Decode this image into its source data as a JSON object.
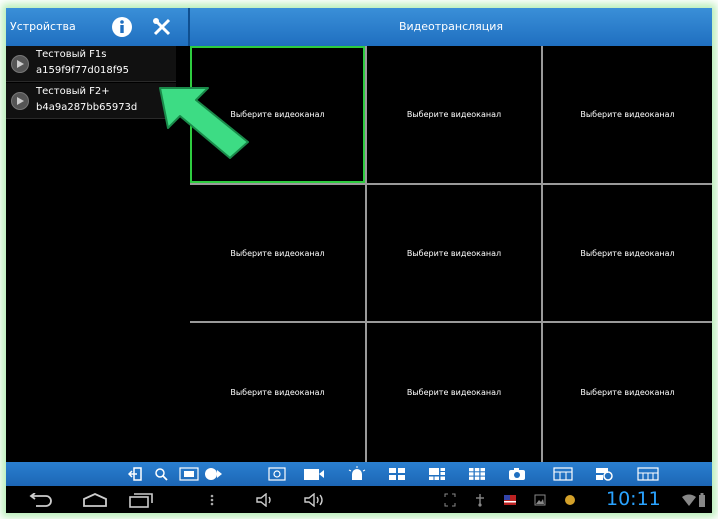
{
  "topbar": {
    "left_title": "Устройства",
    "center_title": "Видеотрансляция"
  },
  "devices": [
    {
      "name": "Тестовый F1s",
      "id": "a159f9f77d018f95"
    },
    {
      "name": "Тестовый F2+",
      "id": "b4a9a287bb65973d"
    }
  ],
  "grid": {
    "cells": [
      "Выберите видеоканал",
      "Выберите видеоканал",
      "Выберите видеоканал",
      "Выберите видеоканал",
      "Выберите видеоканал",
      "Выберите видеоканал",
      "Выберите видеоканал",
      "Выберите видеоканал",
      "Выберите видеоканал"
    ],
    "active_cell": 0,
    "active_color": "#2ecc40"
  },
  "toolbar": {
    "icons": [
      "exit-icon",
      "search-icon",
      "fullscreen-icon",
      "ptz-icon",
      "snapshot-icon",
      "record-icon",
      "alarm-icon",
      "layout-4-icon",
      "layout-6-icon",
      "layout-9-icon",
      "camera-icon",
      "grid-view-icon",
      "playback-icon",
      "timeline-icon"
    ]
  },
  "navbar": {
    "clock": "10:11"
  },
  "colors": {
    "accent": "#1f6fc0",
    "clock": "#2aa3ff",
    "highlight_arrow": "#3ddc84"
  }
}
